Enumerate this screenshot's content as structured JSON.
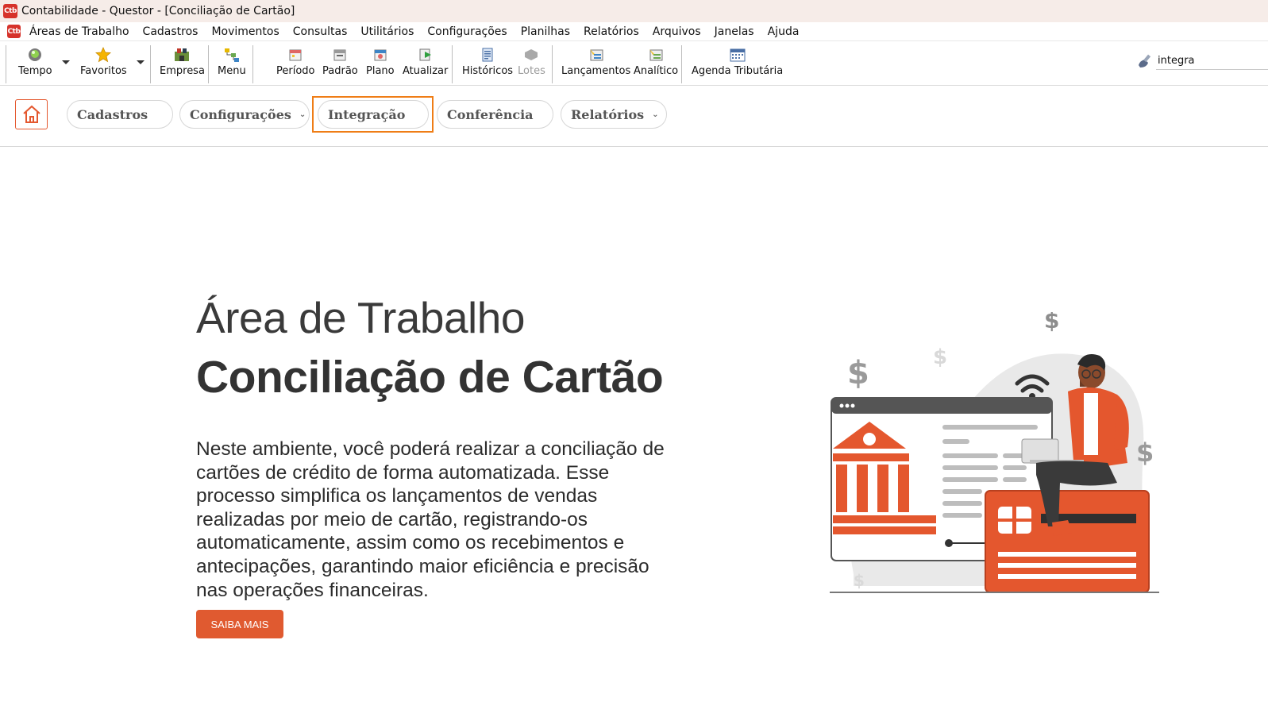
{
  "window": {
    "logo_text": "Ctb",
    "title": "Contabilidade - Questor - [Conciliação de Cartão]"
  },
  "menubar": {
    "items": [
      "Áreas de Trabalho",
      "Cadastros",
      "Movimentos",
      "Consultas",
      "Utilitários",
      "Configurações",
      "Planilhas",
      "Relatórios",
      "Arquivos",
      "Janelas",
      "Ajuda"
    ]
  },
  "toolbar": {
    "tempo": "Tempo",
    "favoritos": "Favoritos",
    "empresa": "Empresa",
    "menu": "Menu",
    "periodo": "Período",
    "padrao": "Padrão",
    "plano": "Plano",
    "atualizar": "Atualizar",
    "historicos": "Históricos",
    "lotes": "Lotes",
    "lancamentos": "Lançamentos",
    "analitico": "Analítico",
    "agenda": "Agenda Tributária",
    "search_value": "integra"
  },
  "nav": {
    "tabs": [
      {
        "label": "Cadastros"
      },
      {
        "label": "Configurações"
      },
      {
        "label": "Integração"
      },
      {
        "label": "Conferência"
      },
      {
        "label": "Relatórios"
      }
    ]
  },
  "hero": {
    "title_light": "Área de Trabalho",
    "title_bold": "Conciliação de Cartão",
    "description": "Neste ambiente, você poderá realizar a conciliação de cartões de crédito de forma automatizada. Esse processo simplifica os lançamentos de vendas realizadas por meio de cartão, registrando-os automaticamente, assim como os recebimentos e antecipações, garantindo maior eficiência e precisão nas operações financeiras.",
    "cta_label": "SAIBA MAIS"
  },
  "illustration": {
    "dollar_symbol": "$"
  },
  "colors": {
    "accent": "#e05a30",
    "highlight": "#ef7d16",
    "logo": "#d6322a"
  }
}
